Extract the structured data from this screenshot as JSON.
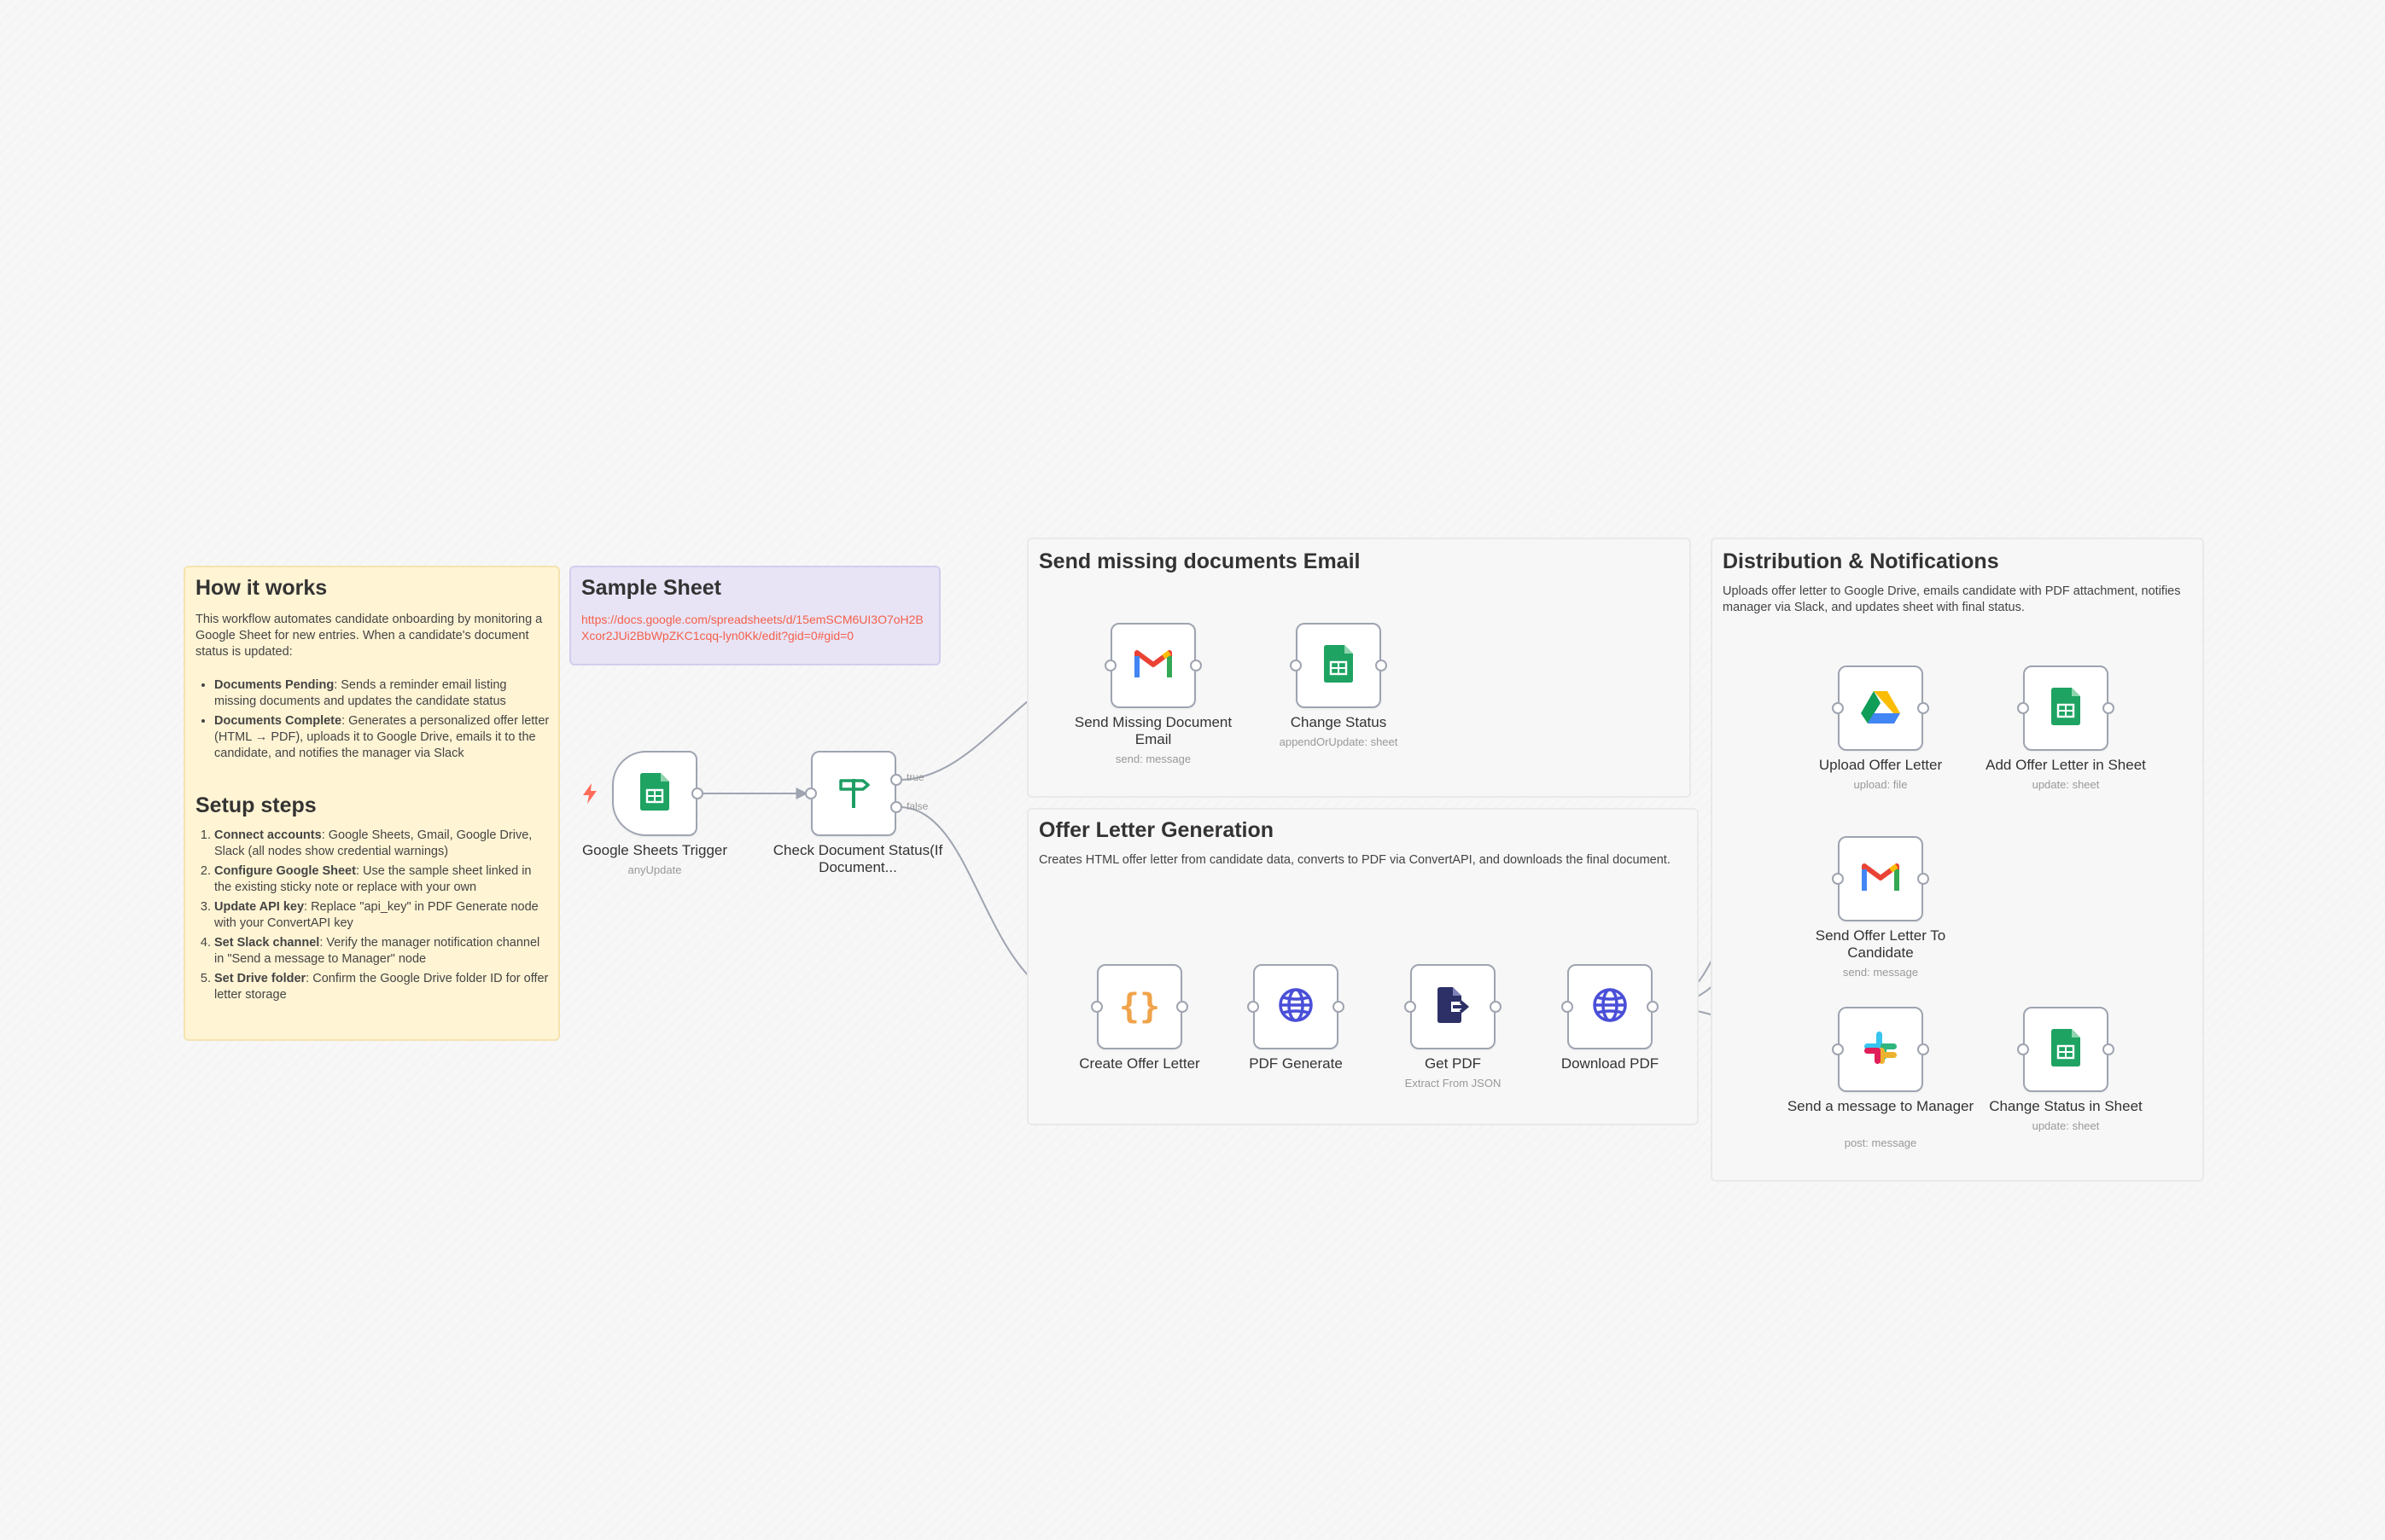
{
  "notes": {
    "how": {
      "title": "How it works",
      "intro": "This workflow automates candidate onboarding by monitoring a Google Sheet for new entries. When a candidate's document status is updated:",
      "bullets": [
        {
          "bold": "Documents Pending",
          "text": ": Sends a reminder email listing missing documents and updates the candidate status"
        },
        {
          "bold": "Documents Complete",
          "text": ": Generates a personalized offer letter (HTML → PDF), uploads it to Google Drive, emails it to the candidate, and notifies the manager via Slack"
        }
      ],
      "setup_title": "Setup steps",
      "steps": [
        {
          "bold": "Connect accounts",
          "text": ": Google Sheets, Gmail, Google Drive, Slack (all nodes show credential warnings)"
        },
        {
          "bold": "Configure Google Sheet",
          "text": ": Use the sample sheet linked in the existing sticky note or replace with your own"
        },
        {
          "bold": "Update API key",
          "text": ": Replace \"api_key\" in PDF Generate node with your ConvertAPI key"
        },
        {
          "bold": "Set Slack channel",
          "text": ": Verify the manager notification channel in \"Send a message to Manager\" node"
        },
        {
          "bold": "Set Drive folder",
          "text": ": Confirm the Google Drive folder ID for offer letter storage"
        }
      ]
    },
    "sample": {
      "title": "Sample Sheet",
      "link": "https://docs.google.com/spreadsheets/d/15emSCM6UI3O7oH2BXcor2JUi2BbWpZKC1cqq-lyn0Kk/edit?gid=0#gid=0"
    },
    "missing": {
      "title": "Send missing documents Email"
    },
    "offer": {
      "title": "Offer Letter Generation",
      "desc": "Creates HTML offer letter from candidate data, converts to PDF via ConvertAPI, and downloads the final document."
    },
    "dist": {
      "title": "Distribution & Notifications",
      "desc": "Uploads offer letter to Google Drive, emails candidate with PDF attachment, notifies manager via Slack, and updates sheet with final status."
    }
  },
  "nodes": {
    "sheets_trigger": {
      "label": "Google Sheets Trigger",
      "sub": "anyUpdate",
      "icon": "google-sheets-icon"
    },
    "check_status": {
      "label": "Check Document Status(If Document...",
      "sub": "",
      "icon": "signpost-icon",
      "branch_true": "true",
      "branch_false": "false"
    },
    "send_missing": {
      "label": "Send Missing Document Email",
      "sub": "send: message",
      "icon": "gmail-icon"
    },
    "change_status": {
      "label": "Change Status",
      "sub": "appendOrUpdate: sheet",
      "icon": "google-sheets-icon"
    },
    "create_offer": {
      "label": "Create Offer Letter",
      "sub": "",
      "icon": "code-braces-icon"
    },
    "pdf_generate": {
      "label": "PDF Generate",
      "sub": "",
      "icon": "globe-icon"
    },
    "get_pdf": {
      "label": "Get PDF",
      "sub": "Extract From JSON",
      "icon": "file-export-icon"
    },
    "download_pdf": {
      "label": "Download PDF",
      "sub": "",
      "icon": "globe-icon"
    },
    "upload_offer": {
      "label": "Upload Offer Letter",
      "sub": "upload: file",
      "icon": "google-drive-icon"
    },
    "add_offer_sheet": {
      "label": "Add Offer Letter in Sheet",
      "sub": "update: sheet",
      "icon": "google-sheets-icon"
    },
    "send_offer": {
      "label": "Send Offer Letter To Candidate",
      "sub": "send: message",
      "icon": "gmail-icon"
    },
    "slack_manager": {
      "label": "Send a message to Manager",
      "sub": "post: message",
      "icon": "slack-icon"
    },
    "change_status_sheet": {
      "label": "Change Status in Sheet",
      "sub": "update: sheet",
      "icon": "google-sheets-icon"
    }
  },
  "colors": {
    "sheets_green": "#1ea362",
    "gmail_red": "#ea4335",
    "code_orange": "#f0a34a",
    "globe_blue": "#4a4fd8",
    "file_navy": "#2d3066",
    "router_green": "#1e9e64",
    "trigger_bolt": "#ff6d5a",
    "link": "#f5604b",
    "node_border": "#9ea4b0",
    "wire": "#9ea4b0"
  }
}
